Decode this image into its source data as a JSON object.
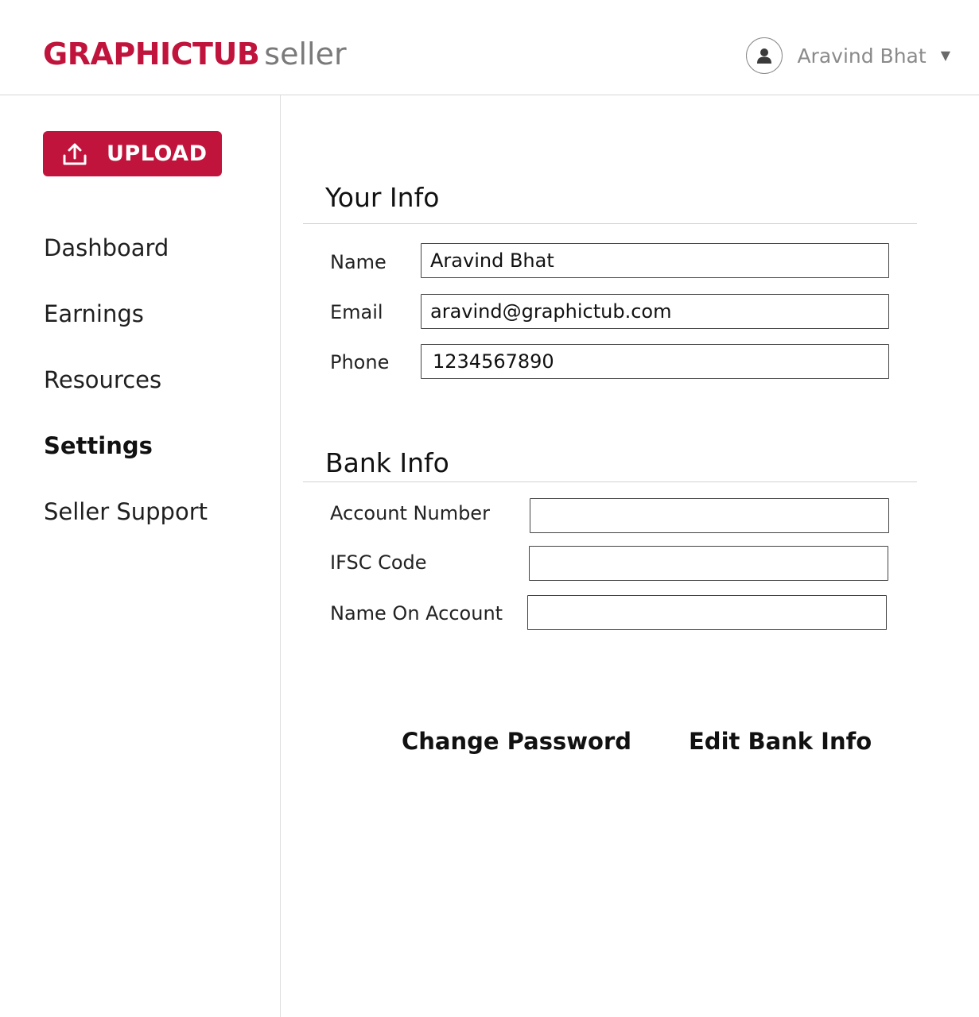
{
  "brand": {
    "name": "GRAPHICTUB",
    "suffix": "seller",
    "accent_color": "#c0143c"
  },
  "user": {
    "name": "Aravind Bhat",
    "avatar_icon": "user-avatar-icon",
    "dropdown_icon": "caret-down-icon",
    "dropdown_glyph": "▼"
  },
  "sidebar": {
    "upload_label": "UPLOAD",
    "upload_icon": "upload-icon",
    "items": [
      {
        "label": "Dashboard",
        "active": false
      },
      {
        "label": "Earnings",
        "active": false
      },
      {
        "label": "Resources",
        "active": false
      },
      {
        "label": "Settings",
        "active": true
      },
      {
        "label": "Seller Support",
        "active": false
      }
    ]
  },
  "your_info": {
    "title": "Your Info",
    "fields": [
      {
        "label": "Name",
        "value": "Aravind Bhat"
      },
      {
        "label": "Email",
        "value": "aravind@graphictub.com"
      },
      {
        "label": "Phone",
        "value": "1234567890"
      }
    ]
  },
  "bank_info": {
    "title": "Bank Info",
    "fields": [
      {
        "label": "Account Number",
        "value": ""
      },
      {
        "label": "IFSC Code",
        "value": ""
      },
      {
        "label": "Name On Account",
        "value": ""
      }
    ]
  },
  "actions": {
    "change_password": "Change Password",
    "edit_bank_info": "Edit Bank Info"
  }
}
